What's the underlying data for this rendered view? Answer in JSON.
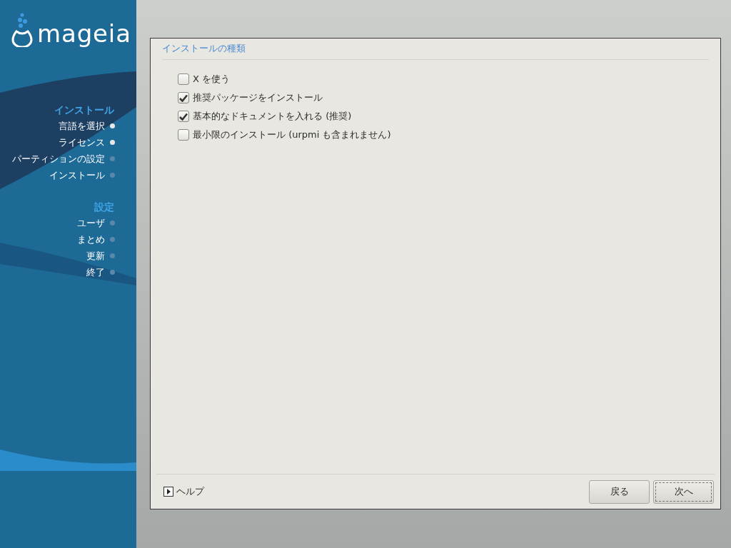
{
  "logo": "mageia",
  "sidebar": {
    "sections": [
      {
        "title": "インストール",
        "items": [
          {
            "label": "言語を選択",
            "done": true
          },
          {
            "label": "ライセンス",
            "done": true
          },
          {
            "label": "パーティションの設定",
            "done": false
          },
          {
            "label": "インストール",
            "done": false
          }
        ]
      },
      {
        "title": "設定",
        "items": [
          {
            "label": "ユーザ",
            "done": false
          },
          {
            "label": "まとめ",
            "done": false
          },
          {
            "label": "更新",
            "done": false
          },
          {
            "label": "終了",
            "done": false
          }
        ]
      }
    ]
  },
  "dialog": {
    "group_title": "インストールの種類",
    "options": [
      {
        "label": "X を使う",
        "checked": false
      },
      {
        "label": "推奨パッケージをインストール",
        "checked": true
      },
      {
        "label": "基本的なドキュメントを入れる (推奨)",
        "checked": true
      },
      {
        "label": "最小限のインストール (urpmi も含まれません)",
        "checked": false
      }
    ],
    "help": "ヘルプ",
    "buttons": [
      {
        "label": "戻る",
        "focused": false
      },
      {
        "label": "次へ",
        "focused": true
      }
    ]
  }
}
